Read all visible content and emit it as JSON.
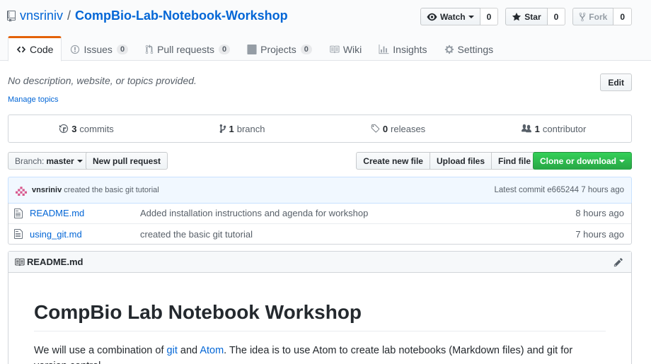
{
  "repo": {
    "owner": "vnsriniv",
    "separator": "/",
    "name": "CompBio-Lab-Notebook-Workshop"
  },
  "actions": {
    "watch": {
      "label": "Watch",
      "count": "0"
    },
    "star": {
      "label": "Star",
      "count": "0"
    },
    "fork": {
      "label": "Fork",
      "count": "0"
    }
  },
  "tabs": [
    {
      "label": "Code",
      "icon": "code-icon"
    },
    {
      "label": "Issues",
      "count": "0",
      "icon": "issue-icon"
    },
    {
      "label": "Pull requests",
      "count": "0",
      "icon": "pull-request-icon"
    },
    {
      "label": "Projects",
      "count": "0",
      "icon": "project-icon"
    },
    {
      "label": "Wiki",
      "icon": "book-icon"
    },
    {
      "label": "Insights",
      "icon": "graph-icon"
    },
    {
      "label": "Settings",
      "icon": "gear-icon"
    }
  ],
  "description": "No description, website, or topics provided.",
  "manage_topics": "Manage topics",
  "edit_label": "Edit",
  "numbers": {
    "commits": {
      "count": "3",
      "label": "commits"
    },
    "branches": {
      "count": "1",
      "label": "branch"
    },
    "releases": {
      "count": "0",
      "label": "releases"
    },
    "contributors": {
      "count": "1",
      "label": "contributor"
    }
  },
  "file_nav": {
    "branch_prefix": "Branch:",
    "branch": "master",
    "new_pr": "New pull request",
    "create_file": "Create new file",
    "upload_files": "Upload files",
    "find_file": "Find file",
    "clone": "Clone or download"
  },
  "latest_commit": {
    "author": "vnsriniv",
    "message": "created the basic git tutorial",
    "summary": "Latest commit e665244 7 hours ago"
  },
  "files": [
    {
      "name": "README.md",
      "message": "Added installation instructions and agenda for workshop",
      "age": "8 hours ago"
    },
    {
      "name": "using_git.md",
      "message": "created the basic git tutorial",
      "age": "7 hours ago"
    }
  ],
  "readme": {
    "filename": "README.md",
    "heading": "CompBio Lab Notebook Workshop",
    "p_start": "We will use a combination of ",
    "link_git": "git",
    "p_and": " and ",
    "link_atom": "Atom",
    "p_end": ". The idea is to use Atom to create lab notebooks (Markdown files) and git for version control."
  },
  "colors": {
    "accent_tab": "#e36209",
    "link": "#0366d6",
    "primary_btn": "#28a745"
  }
}
